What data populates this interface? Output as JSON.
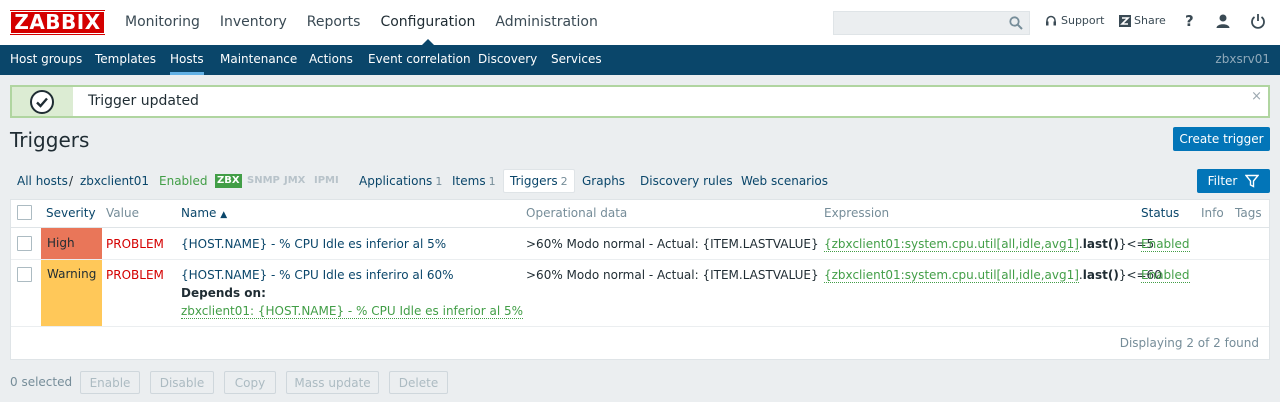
{
  "app": {
    "logo": "ZABBIX"
  },
  "top_nav": [
    "Monitoring",
    "Inventory",
    "Reports",
    "Configuration",
    "Administration"
  ],
  "top_nav_active": "Configuration",
  "header_links": {
    "support": "Support",
    "share": "Share",
    "help": "?"
  },
  "sub_nav": [
    "Host groups",
    "Templates",
    "Hosts",
    "Maintenance",
    "Actions",
    "Event correlation",
    "Discovery",
    "Services"
  ],
  "sub_nav_active": "Hosts",
  "server_name": "zbxsrv01",
  "message": {
    "text": "Trigger updated",
    "close": "×"
  },
  "page": {
    "title": "Triggers",
    "create_button": "Create trigger",
    "filter_button": "Filter"
  },
  "host_bar": {
    "all_hosts": "All hosts",
    "separator": "/",
    "host": "zbxclient01",
    "status": "Enabled",
    "protocols": [
      {
        "label": "ZBX",
        "active": true
      },
      {
        "label": "SNMP",
        "active": false
      },
      {
        "label": "JMX",
        "active": false
      },
      {
        "label": "IPMI",
        "active": false
      }
    ],
    "applications": {
      "label": "Applications",
      "count": "1"
    },
    "items": {
      "label": "Items",
      "count": "1"
    },
    "triggers": {
      "label": "Triggers",
      "count": "2"
    },
    "graphs": "Graphs",
    "discovery_rules": "Discovery rules",
    "web_scenarios": "Web scenarios"
  },
  "table": {
    "columns": {
      "severity": "Severity",
      "value": "Value",
      "name": "Name",
      "sort_indicator": "▲",
      "operational_data": "Operational data",
      "expression": "Expression",
      "status": "Status",
      "info": "Info",
      "tags": "Tags"
    },
    "rows": [
      {
        "severity": "High",
        "severity_color": "#e97659",
        "value": "PROBLEM",
        "name": "{HOST.NAME} - % CPU Idle es inferior al 5%",
        "operational_data": ">60% Modo normal - Actual: {ITEM.LASTVALUE}",
        "expr_item": "{zbxclient01:system.cpu.util[all,idle,avg1]",
        "expr_dot": ".",
        "expr_func": "last()",
        "expr_tail": "}<=5",
        "status": "Enabled"
      },
      {
        "severity": "Warning",
        "severity_color": "#ffc859",
        "value": "PROBLEM",
        "name": "{HOST.NAME} - % CPU Idle es inferiro al 60%",
        "depends_label": "Depends on:",
        "depends_link": "zbxclient01: {HOST.NAME} - % CPU Idle es inferior al 5%",
        "operational_data": ">60% Modo normal - Actual: {ITEM.LASTVALUE}",
        "expr_item": "{zbxclient01:system.cpu.util[all,idle,avg1]",
        "expr_dot": ".",
        "expr_func": "last()",
        "expr_tail": "}<=60",
        "status": "Enabled"
      }
    ],
    "footer": "Displaying 2 of 2 found"
  },
  "bottom": {
    "selected": "0 selected",
    "buttons": [
      "Enable",
      "Disable",
      "Copy",
      "Mass update",
      "Delete"
    ]
  }
}
